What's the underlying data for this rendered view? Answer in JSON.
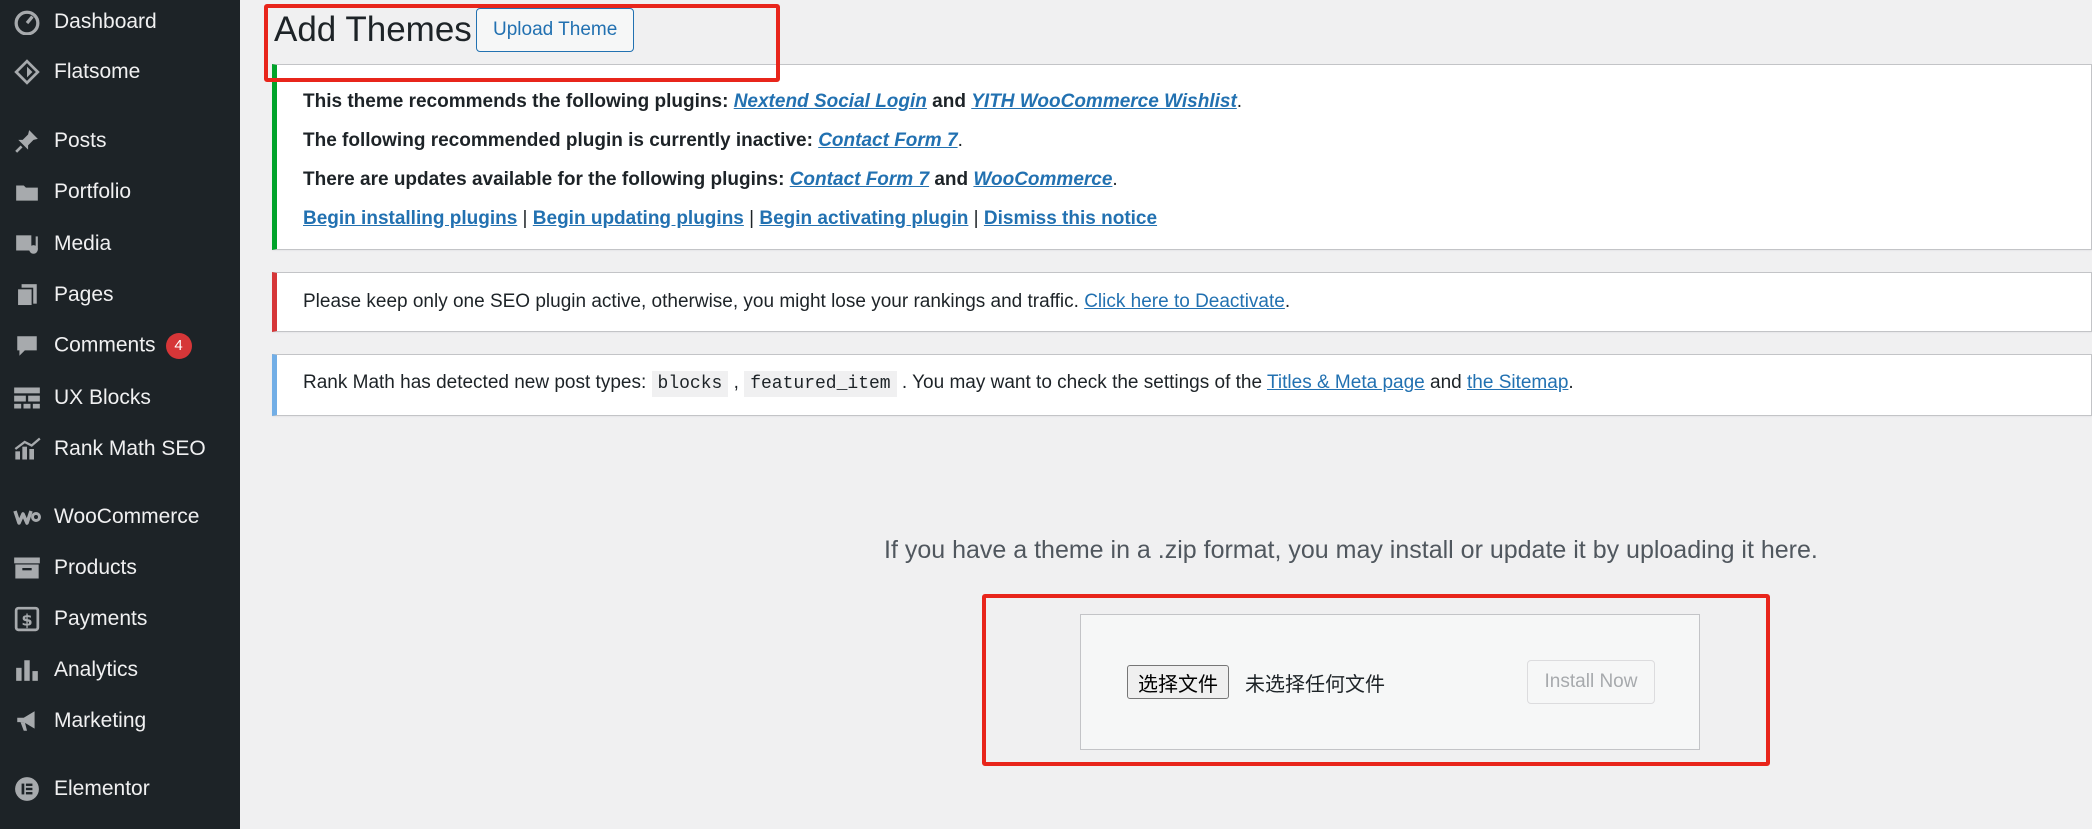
{
  "sidebar": {
    "items": [
      {
        "label": "Dashboard",
        "icon": "dashboard-icon"
      },
      {
        "label": "Flatsome",
        "icon": "diamond-icon"
      },
      {
        "label": "Posts",
        "icon": "pin-icon"
      },
      {
        "label": "Portfolio",
        "icon": "folder-icon"
      },
      {
        "label": "Media",
        "icon": "media-icon"
      },
      {
        "label": "Pages",
        "icon": "pages-icon"
      },
      {
        "label": "Comments",
        "icon": "comment-icon",
        "badge": "4"
      },
      {
        "label": "UX Blocks",
        "icon": "blocks-icon"
      },
      {
        "label": "Rank Math SEO",
        "icon": "chart-icon"
      },
      {
        "label": "WooCommerce",
        "icon": "woocommerce-icon"
      },
      {
        "label": "Products",
        "icon": "archive-icon"
      },
      {
        "label": "Payments",
        "icon": "dollar-icon"
      },
      {
        "label": "Analytics",
        "icon": "bar-chart-icon"
      },
      {
        "label": "Marketing",
        "icon": "megaphone-icon"
      },
      {
        "label": "Elementor",
        "icon": "elementor-icon"
      }
    ]
  },
  "header": {
    "title": "Add Themes",
    "upload_button": "Upload Theme"
  },
  "notices": {
    "plugins": {
      "line1_text": "This theme recommends the following plugins: ",
      "line1_link1": "Nextend Social Login",
      "line1_and": " and ",
      "line1_link2": "YITH WooCommerce Wishlist",
      "line1_end": ".",
      "line2_text": "The following recommended plugin is currently inactive: ",
      "line2_link": "Contact Form 7",
      "line2_end": ".",
      "line3_text": "There are updates available for the following plugins: ",
      "line3_link1": "Contact Form 7",
      "line3_and": " and ",
      "line3_link2": "WooCommerce",
      "line3_end": ".",
      "actions": [
        "Begin installing plugins",
        "Begin updating plugins",
        "Begin activating plugin",
        "Dismiss this notice"
      ],
      "separator": " | "
    },
    "seo": {
      "text": "Please keep only one SEO plugin active, otherwise, you might lose your rankings and traffic. ",
      "link": "Click here to Deactivate",
      "end": "."
    },
    "rankmath": {
      "text1": "Rank Math has detected new post types: ",
      "code1": "blocks",
      "comma": " , ",
      "code2": "featured_item",
      "text2": " . You may want to check the settings of the ",
      "link1": "Titles & Meta page",
      "and": " and ",
      "link2": "the Sitemap",
      "end": "."
    }
  },
  "upload": {
    "description": "If you have a theme in a .zip format, you may install or update it by uploading it here.",
    "choose_file": "选择文件",
    "no_file": "未选择任何文件",
    "install_button": "Install Now"
  },
  "colors": {
    "sidebar_bg": "#1d2327",
    "accent": "#2271b1",
    "annotation": "#e8251b",
    "notice_success": "#00a32a",
    "notice_error": "#d63638",
    "notice_info": "#72aee6"
  }
}
